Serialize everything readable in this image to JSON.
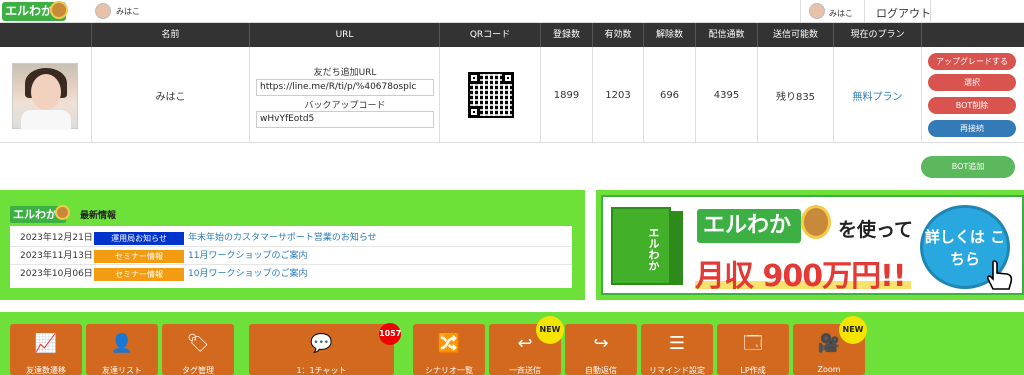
{
  "topbar": {
    "brand": "エルわか",
    "user_name": "みはこ",
    "user_name_right": "みはこ",
    "logout": "ログアウト"
  },
  "table": {
    "headers": [
      "名前",
      "URL",
      "QRコード",
      "登録数",
      "有効数",
      "解除数",
      "配信通数",
      "送信可能数",
      "現在のプラン"
    ],
    "row": {
      "name": "みはこ",
      "friend_url_label": "友だち追加URL",
      "friend_url": "https://line.me/R/ti/p/%40678osplc",
      "backup_label": "バックアップコード",
      "backup_code": "wHvYfEotd5",
      "registered": "1899",
      "active": "1203",
      "cancelled": "696",
      "sent": "4395",
      "remaining": "残り835",
      "plan": "無料プラン"
    },
    "actions": {
      "upgrade": "アップグレードする",
      "select": "選択",
      "bot_delete": "BOT削除",
      "reconnect": "再接続"
    },
    "bot_add": "BOT追加"
  },
  "news": {
    "logo": "エルわか",
    "title": "最新情報",
    "items": [
      {
        "date": "2023年12月21日",
        "tag": "運用局お知らせ",
        "text": "年末年始のカスタマーサポート営業のお知らせ"
      },
      {
        "date": "2023年11月13日",
        "tag": "セミナー情報",
        "text": "11月ワークショップのご案内"
      },
      {
        "date": "2023年10月06日",
        "tag": "セミナー情報",
        "text": "10月ワークショップのご案内"
      }
    ]
  },
  "banner": {
    "brand": "エルわか",
    "using": "を使って",
    "income": "月収 900万円!!",
    "cta": "詳しくは こちら"
  },
  "bottom_nav": {
    "items": [
      {
        "icon": "chart-icon",
        "glyph": "📈",
        "label": "友達数遷移"
      },
      {
        "icon": "user-icon",
        "glyph": "👤",
        "label": "友達リスト"
      },
      {
        "icon": "tag-icon",
        "glyph": "🏷",
        "label": "タグ管理"
      },
      {
        "icon": "chat-icon",
        "glyph": "💬",
        "label": "1：1チャット",
        "badge": "1057"
      },
      {
        "icon": "shuffle-icon",
        "glyph": "🔀",
        "label": "シナリオ一覧"
      },
      {
        "icon": "reply-icon",
        "glyph": "↩",
        "label": "一斉送信",
        "badge_new": "NEW"
      },
      {
        "icon": "return-icon",
        "glyph": "↪",
        "label": "自動返信"
      },
      {
        "icon": "list-icon",
        "glyph": "☰",
        "label": "リマインド設定"
      },
      {
        "icon": "lp-icon",
        "glyph": "🗔",
        "label": "LP作成"
      },
      {
        "icon": "video-icon",
        "glyph": "🎥",
        "label": "Zoom",
        "badge_new": "NEW"
      }
    ]
  },
  "colors": {
    "green": "#6ee03a",
    "tile": "#d2691e",
    "header": "#333333"
  }
}
